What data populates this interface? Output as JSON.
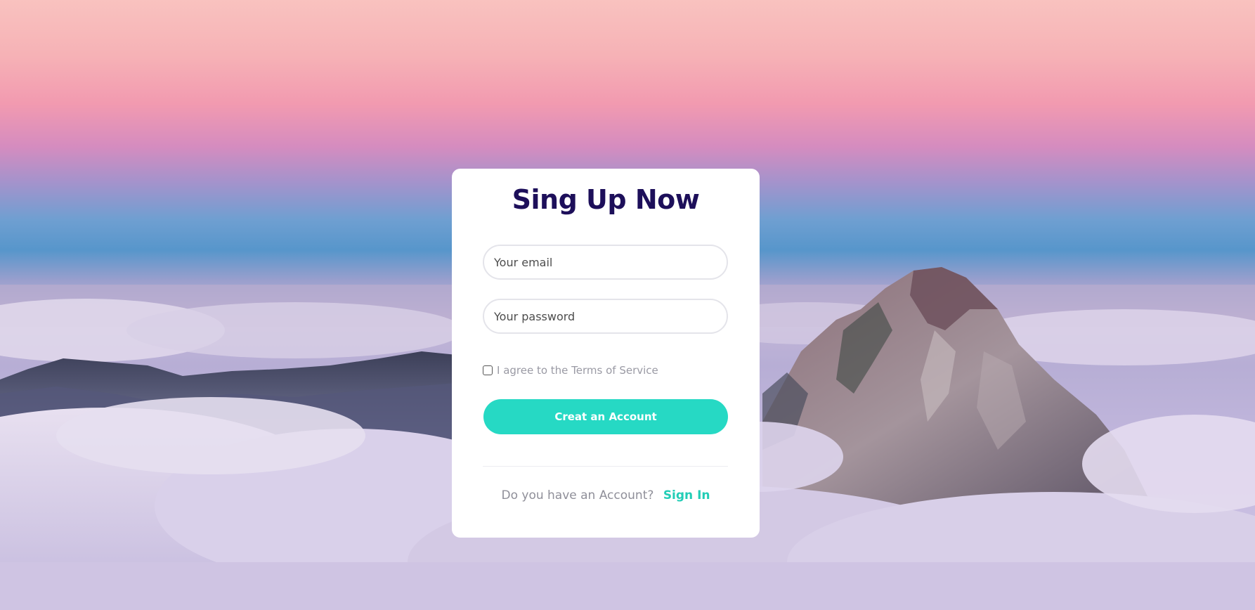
{
  "form": {
    "title": "Sing Up Now",
    "email_placeholder": "Your email",
    "password_placeholder": "Your password",
    "terms_label": "I agree to the Terms of Service",
    "terms_checked": false,
    "submit_label": "Creat an Account",
    "footer_text": "Do you have an Account?",
    "signin_label": "Sign In"
  },
  "colors": {
    "title": "#1d0f5a",
    "accent": "#26d9c4",
    "card": "#ffffff"
  }
}
